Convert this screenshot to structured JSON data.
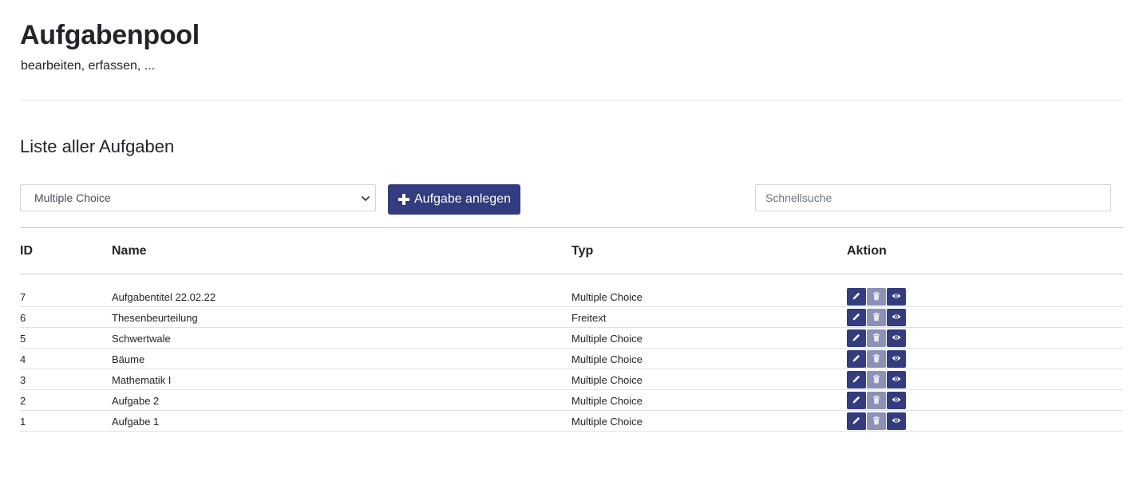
{
  "header": {
    "title": "Aufgabenpool",
    "subtitle": "bearbeiten, erfassen, ..."
  },
  "section": {
    "title": "Liste aller Aufgaben"
  },
  "filter": {
    "selected": "Multiple Choice"
  },
  "add_button": {
    "label": "Aufgabe anlegen",
    "icon": "plus-icon"
  },
  "search": {
    "placeholder": "Schnellsuche",
    "value": ""
  },
  "table": {
    "columns": [
      "ID",
      "Name",
      "Typ",
      "Aktion"
    ],
    "rows": [
      {
        "id": "7",
        "name": "Aufgabentitel 22.02.22",
        "typ": "Multiple Choice"
      },
      {
        "id": "6",
        "name": "Thesenbeurteilung",
        "typ": "Freitext"
      },
      {
        "id": "5",
        "name": "Schwertwale",
        "typ": "Multiple Choice"
      },
      {
        "id": "4",
        "name": "Bäume",
        "typ": "Multiple Choice"
      },
      {
        "id": "3",
        "name": "Mathematik I",
        "typ": "Multiple Choice"
      },
      {
        "id": "2",
        "name": "Aufgabe 2",
        "typ": "Multiple Choice"
      },
      {
        "id": "1",
        "name": "Aufgabe 1",
        "typ": "Multiple Choice"
      }
    ],
    "action_icons": [
      "pencil-icon",
      "trash-icon",
      "eye-icon"
    ]
  },
  "colors": {
    "primary": "#323c7e",
    "disabled": "#8c91b5",
    "text": "#212529",
    "border": "#ced4da"
  }
}
